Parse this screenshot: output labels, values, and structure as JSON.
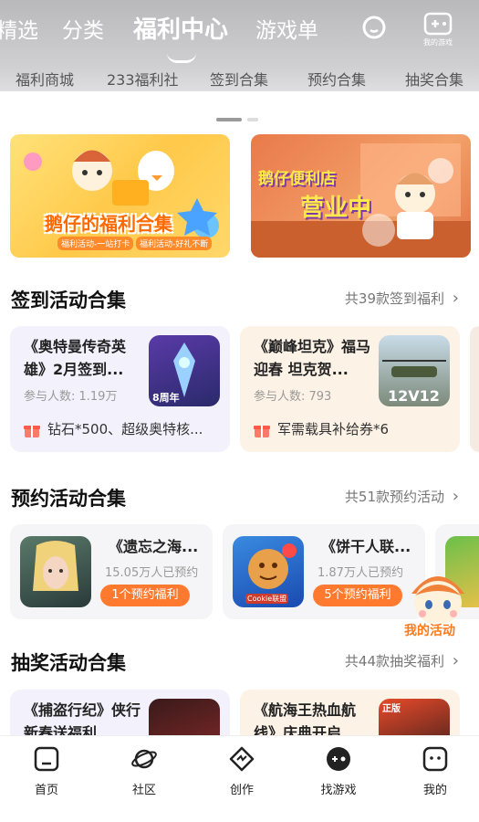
{
  "top_tabs": [
    "精选",
    "分类",
    "福利中心",
    "游戏单"
  ],
  "top_icons": {
    "search": "search-icon",
    "my_games": "我的游戏"
  },
  "sub_tabs": [
    "福利商城",
    "233福利社",
    "签到合集",
    "预约合集",
    "抽奖合集"
  ],
  "banners": [
    {
      "title": "鹅仔的福利合集",
      "sub_1": "福利活动-一站打卡",
      "sub_2": "福利活动-好礼不断"
    },
    {
      "title": "鹅仔便利店",
      "tag": "营业中"
    }
  ],
  "signin": {
    "title": "签到活动合集",
    "more": "共39款签到福利",
    "cards": [
      {
        "title": "《奥特曼传奇英雄》2月签到...",
        "participants": "参与人数: 1.19万",
        "reward": "钻石*500、超级奥特核...",
        "badge": "8周年"
      },
      {
        "title": "《巅峰坦克》福马迎春 坦克贺...",
        "participants": "参与人数: 793",
        "reward": "军需载具补给券*6",
        "badge": "12V12"
      }
    ]
  },
  "reserve": {
    "title": "预约活动合集",
    "more": "共51款预约活动",
    "cards": [
      {
        "title": "《遗忘之海...",
        "count": "15.05万人已预约",
        "pill": "1个预约福利"
      },
      {
        "title": "《饼干人联...",
        "count": "1.87万人已预约",
        "pill": "5个预约福利",
        "logo": "Cookie联盟"
      }
    ]
  },
  "float_widget": {
    "label": "我的活动"
  },
  "lottery": {
    "title": "抽奖活动合集",
    "more": "共44款抽奖福利",
    "cards": [
      {
        "title": "《捕盗行纪》侠行新春送福利"
      },
      {
        "title": "《航海王热血航线》庆典开启",
        "badge": "正版"
      }
    ]
  },
  "bottom_nav": [
    {
      "label": "首页",
      "icon": "home-icon"
    },
    {
      "label": "社区",
      "icon": "planet-icon"
    },
    {
      "label": "创作",
      "icon": "create-icon"
    },
    {
      "label": "找游戏",
      "icon": "find-game-icon"
    },
    {
      "label": "我的",
      "icon": "profile-icon"
    }
  ],
  "colors": {
    "accent": "#ff7a2e",
    "signin_card_1": "#f3f1fb",
    "signin_card_2": "#fdf2e6"
  }
}
